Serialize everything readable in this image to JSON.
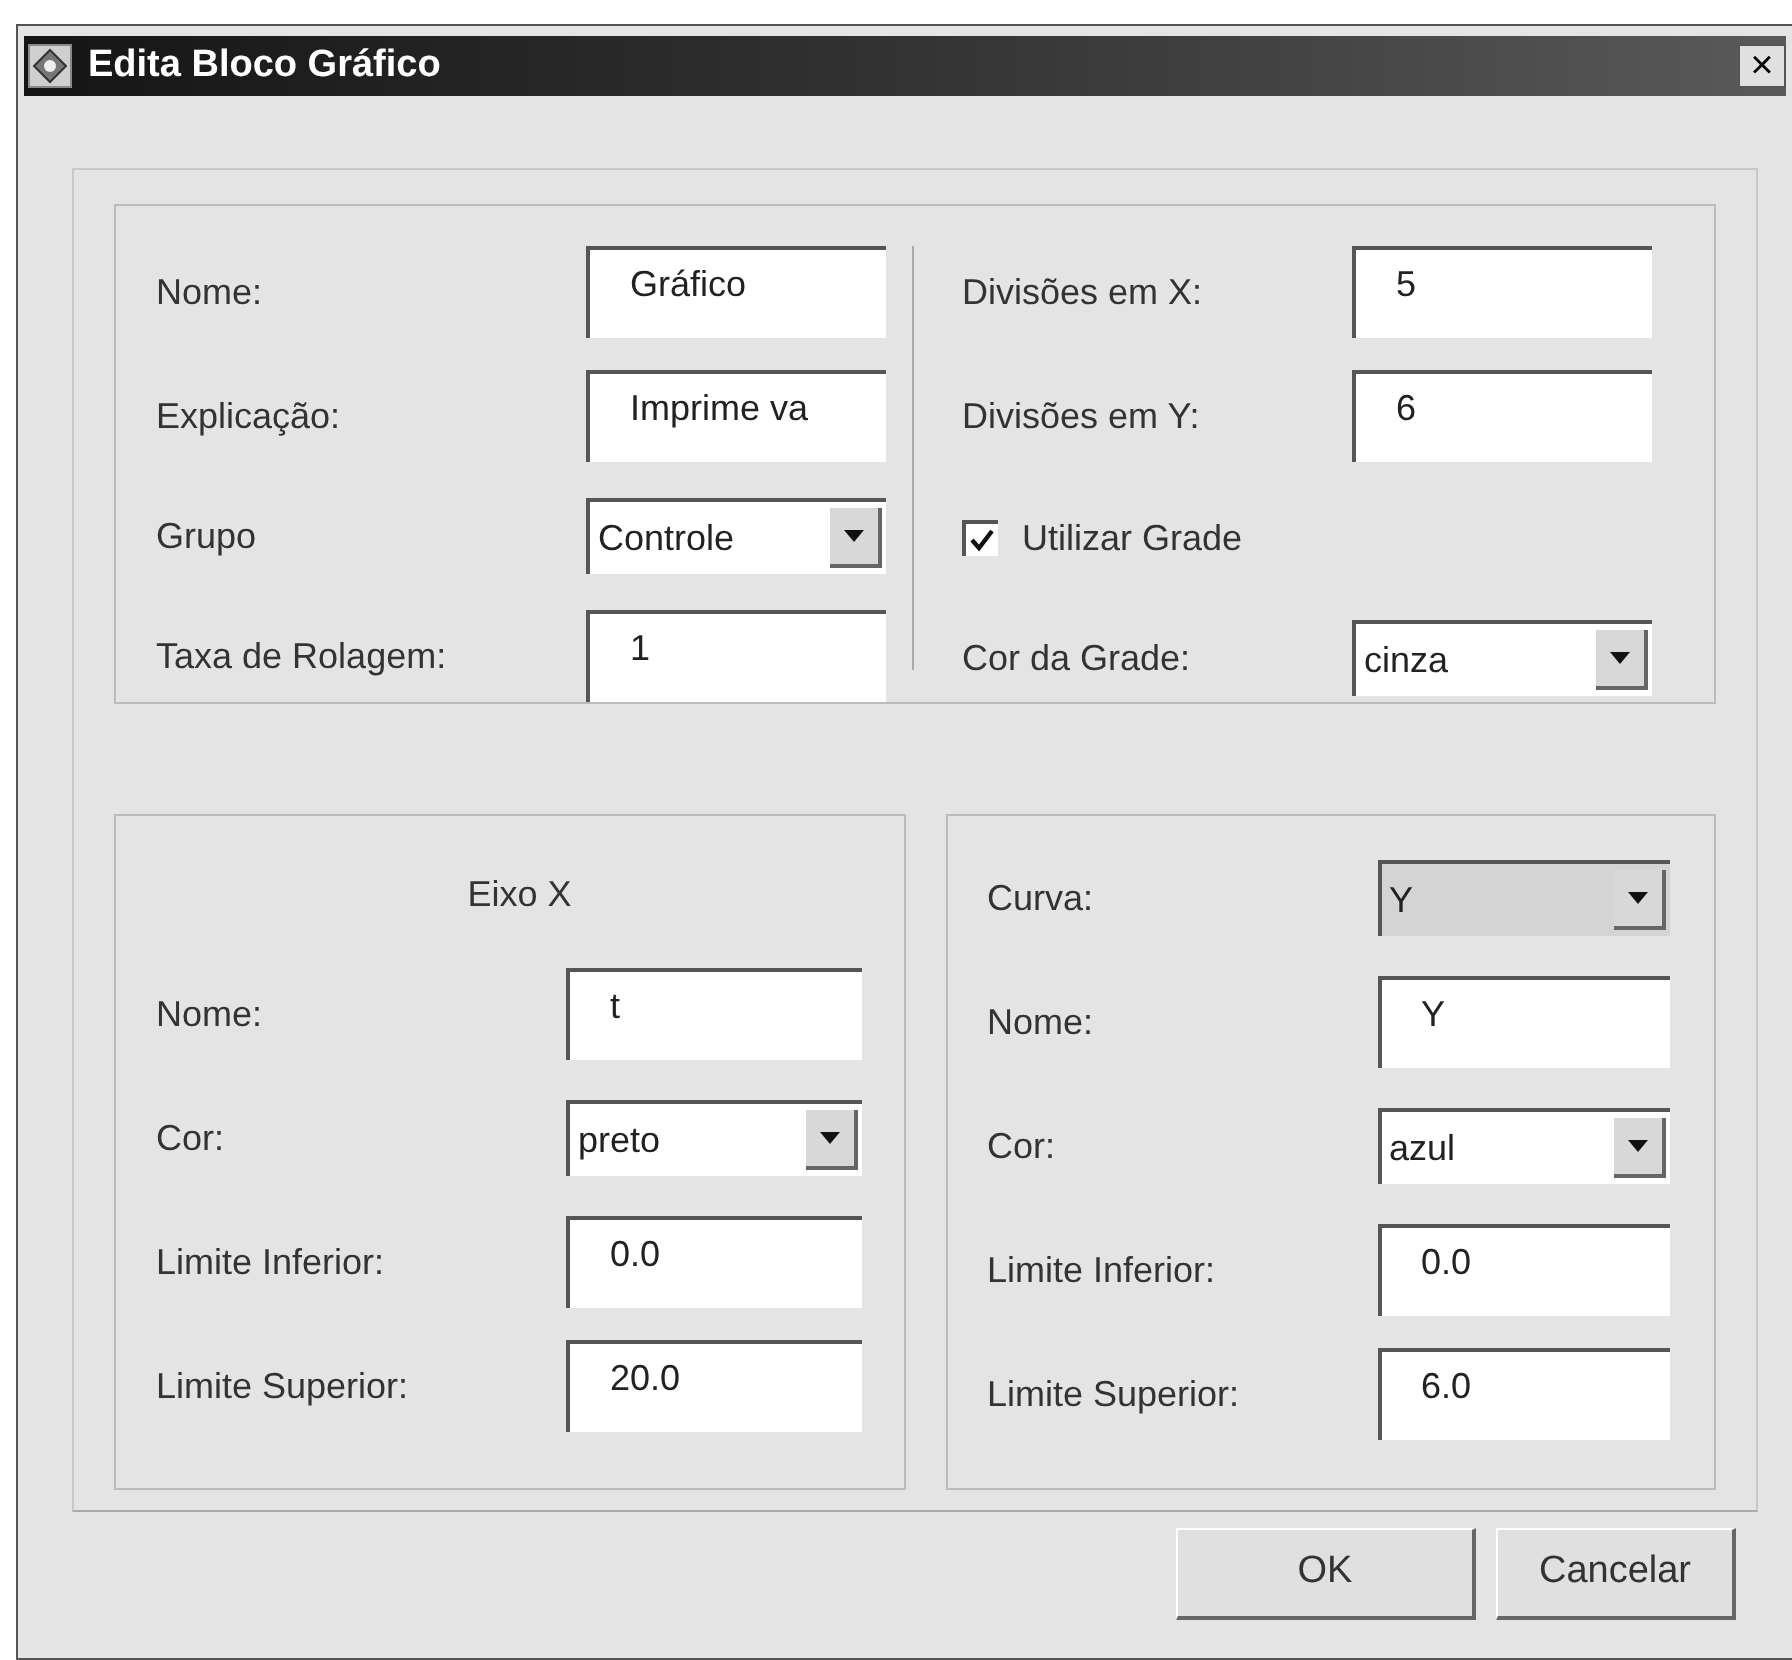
{
  "window": {
    "title": "Edita Bloco Gráfico",
    "close": "×"
  },
  "general": [
    {
      "label": "Nome:",
      "kind": "text",
      "value": "Gráfico",
      "disabled": false
    },
    {
      "label": "Explicação:",
      "kind": "text",
      "value": "Imprime va",
      "disabled": false
    },
    {
      "label": "Grupo",
      "kind": "select",
      "value": "Controle",
      "disabled": false
    },
    {
      "label": "Taxa de Rolagem:",
      "kind": "text",
      "value": "1",
      "disabled": false
    }
  ],
  "grid": [
    {
      "label": "Divisões em X:",
      "kind": "text",
      "value": "5",
      "disabled": false
    },
    {
      "label": "Divisões em Y:",
      "kind": "text",
      "value": "6",
      "disabled": false
    },
    {
      "label": "Utilizar Grade",
      "kind": "checkbox",
      "checked": true
    },
    {
      "label": "Cor da Grade:",
      "kind": "select",
      "value": "cinza",
      "disabled": false
    }
  ],
  "axis_x": {
    "title": "Eixo X",
    "fields": [
      {
        "label": "Nome:",
        "kind": "text",
        "value": "t",
        "disabled": false
      },
      {
        "label": "Cor:",
        "kind": "select",
        "value": "preto",
        "disabled": false
      },
      {
        "label": "Limite Inferior:",
        "kind": "text",
        "value": "0.0",
        "disabled": false
      },
      {
        "label": "Limite Superior:",
        "kind": "text",
        "value": "20.0",
        "disabled": false
      }
    ]
  },
  "curve": {
    "fields": [
      {
        "label": "Curva:",
        "kind": "select",
        "value": "Y",
        "disabled": true
      },
      {
        "label": "Nome:",
        "kind": "text",
        "value": "Y",
        "disabled": false
      },
      {
        "label": "Cor:",
        "kind": "select",
        "value": "azul",
        "disabled": false
      },
      {
        "label": "Limite Inferior:",
        "kind": "text",
        "value": "0.0",
        "disabled": false
      },
      {
        "label": "Limite Superior:",
        "kind": "text",
        "value": "6.0",
        "disabled": false
      }
    ]
  },
  "buttons": [
    "OK",
    "Cancelar"
  ]
}
